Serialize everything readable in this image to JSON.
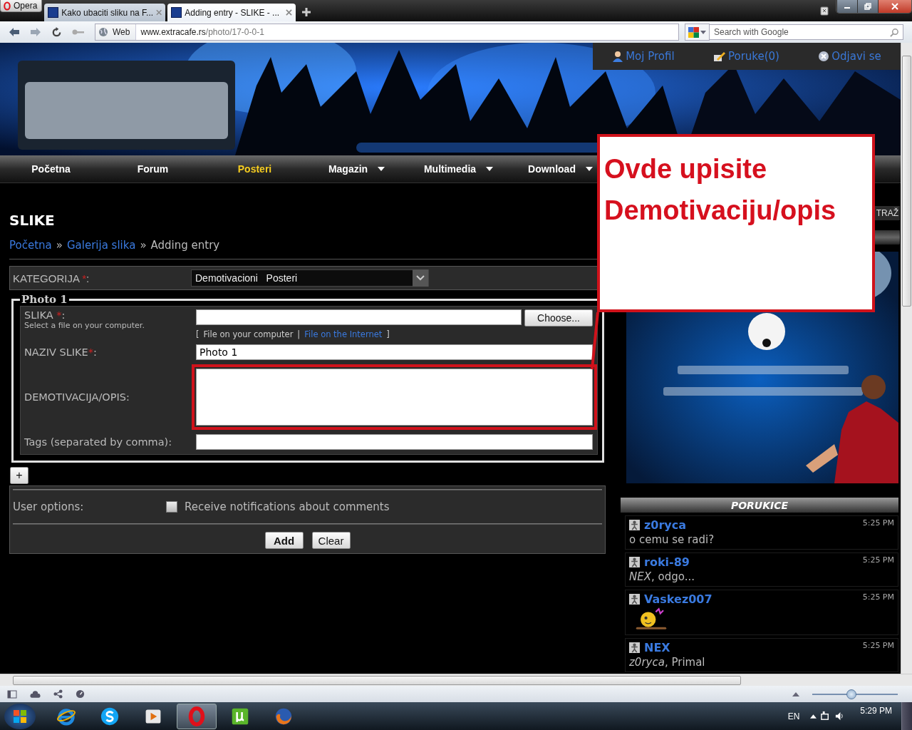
{
  "browser": {
    "menu_button": "Opera",
    "tabs": [
      {
        "title": "Kako ubaciti sliku na F...",
        "selected": false
      },
      {
        "title": "Adding entry - SLIKE - ...",
        "selected": true
      }
    ],
    "address_bar": {
      "site_badge": "Web",
      "url_host": "www.extracafe.rs",
      "url_path": "/photo/17-0-0-1"
    },
    "search": {
      "placeholder": "Search with Google"
    }
  },
  "user_menu": [
    {
      "label": "Moj Profil",
      "kind": "profile"
    },
    {
      "label": "Poruke(0)",
      "kind": "messages"
    },
    {
      "label": "Odjavi se",
      "kind": "logout"
    }
  ],
  "nav": [
    {
      "label": "Početna",
      "selected": false,
      "dropdown": false
    },
    {
      "label": "Forum",
      "selected": false,
      "dropdown": false
    },
    {
      "label": "Posteri",
      "selected": true,
      "dropdown": false
    },
    {
      "label": "Magazin",
      "selected": false,
      "dropdown": true
    },
    {
      "label": "Multimedia",
      "selected": false,
      "dropdown": true
    },
    {
      "label": "Download",
      "selected": false,
      "dropdown": true
    }
  ],
  "page_title": "SLIKE",
  "breadcrumb": [
    {
      "text": "Početna",
      "kind": "link"
    },
    {
      "text": "»",
      "kind": "separator"
    },
    {
      "text": "Galerija slika",
      "kind": "link"
    },
    {
      "text": "»",
      "kind": "separator"
    },
    {
      "text": "Adding entry",
      "kind": "current"
    }
  ],
  "category": {
    "label": "KATEGORIJA",
    "mark": "*",
    "end": ":",
    "value": "Demotivacioni   Posteri"
  },
  "photo": {
    "legend": "Photo 1",
    "fields": [
      {
        "kind": "file",
        "label": "SLIKA",
        "mark": "*",
        "end": ":",
        "hint": "Select a file on your computer.",
        "button": "Choose...",
        "sources": [
          {
            "text": "[",
            "kind": "bracket"
          },
          {
            "text": "File on your computer",
            "kind": "current"
          },
          {
            "text": "|",
            "kind": "bracket"
          },
          {
            "text": "File on the Internet",
            "kind": "link"
          },
          {
            "text": "]",
            "kind": "bracket"
          }
        ]
      },
      {
        "kind": "text",
        "label": "NAZIV SLIKE",
        "mark": "*",
        "end": ":",
        "value": "Photo 1"
      },
      {
        "kind": "textarea",
        "label": "DEMOTIVACIJA/OPIS:",
        "highlighted": true
      },
      {
        "kind": "text",
        "label": "Tags (separated by comma):"
      }
    ]
  },
  "add_photo_button": "+",
  "user_options": {
    "label": "User options:",
    "checkbox": {
      "label": "Receive notifications about comments",
      "checked": false
    }
  },
  "buttons": [
    {
      "label": "Add",
      "primary": true
    },
    {
      "label": "Clear",
      "primary": false
    }
  ],
  "callout": {
    "lines": [
      "Ovde upisite",
      "Demotivaciju/opis"
    ]
  },
  "sidebar": {
    "search_button": "TRAŽ",
    "chat": {
      "title": "PORUKICE",
      "messages": [
        {
          "user": "z0ryca",
          "time": "5:25 PM",
          "kind": "text",
          "text": "o cemu se radi?"
        },
        {
          "user": "roki-89",
          "time": "5:25 PM",
          "kind": "text",
          "text": "*NEX*, odgo..."
        },
        {
          "user": "Vaskez007",
          "time": "5:25 PM",
          "kind": "emoticon"
        },
        {
          "user": "NEX",
          "time": "5:25 PM",
          "kind": "text",
          "text": "*z0ryca*, Primal"
        }
      ]
    }
  },
  "status_bar": {
    "zoom": {
      "level": 0.46
    }
  },
  "taskbar": {
    "apps": [
      {
        "kind": "ie",
        "selected": false
      },
      {
        "kind": "skype",
        "selected": false
      },
      {
        "kind": "media",
        "selected": false
      },
      {
        "kind": "opera",
        "selected": true
      },
      {
        "kind": "torrent",
        "selected": false
      },
      {
        "kind": "firefox",
        "selected": false
      }
    ],
    "language": "EN",
    "clock": "5:29 PM"
  }
}
